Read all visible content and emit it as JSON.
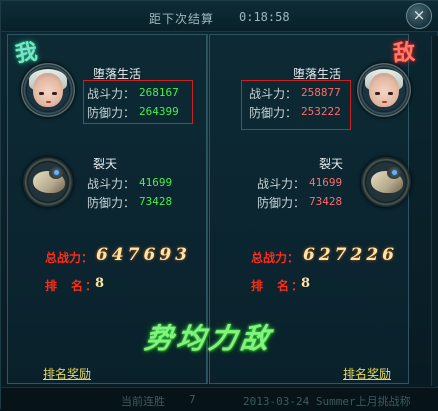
{
  "header": {
    "timer_label": "距下次结算",
    "timer_value": "0:18:58",
    "close_label": "×"
  },
  "self": {
    "badge": "我",
    "name": "堕落生活",
    "attack_label": "战斗力：",
    "attack_value": "268167",
    "defense_label": "防御力：",
    "defense_value": "264399",
    "pet": {
      "name": "裂天",
      "attack_label": "战斗力：",
      "attack_value": "41699",
      "defense_label": "防御力：",
      "defense_value": "73428"
    },
    "total_label": "总战力：",
    "total_value": "647693",
    "rank_label": "排名",
    "rank_value": "8",
    "reward_link": "排名奖励"
  },
  "enemy": {
    "badge": "敌",
    "name": "堕落生活",
    "attack_label": "战斗力：",
    "attack_value": "258877",
    "defense_label": "防御力：",
    "defense_value": "253222",
    "pet": {
      "name": "裂天",
      "attack_label": "战斗力：",
      "attack_value": "41699",
      "defense_label": "防御力：",
      "defense_value": "73428"
    },
    "total_label": "总战力：",
    "total_value": "627226",
    "rank_label": "排名",
    "rank_value": "8",
    "reward_link": "排名奖励"
  },
  "result_text": "势均力敌",
  "footer": {
    "left_label": "当前连胜",
    "left_value": "7",
    "right_text": "2013-03-24  Summer上月挑战称"
  },
  "colors": {
    "self_value": "#46f04a",
    "enemy_value": "#ff6b6b",
    "highlight_box": "#cc1f1f",
    "total_label": "#ff2b1a",
    "result_glow": "#13b51c"
  }
}
